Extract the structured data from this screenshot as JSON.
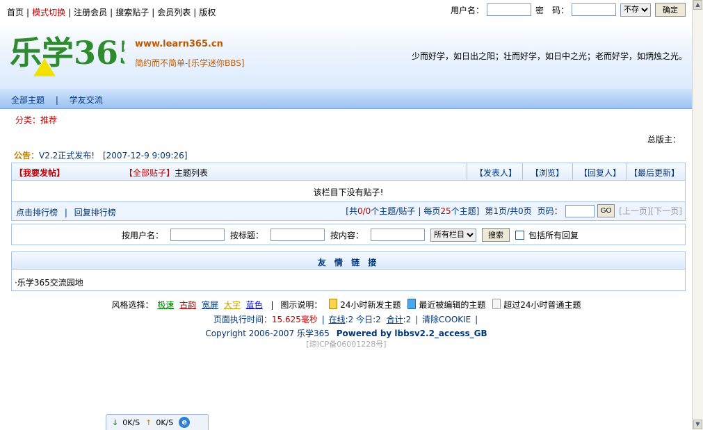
{
  "topnav": {
    "home": "首页",
    "mode": "模式切换",
    "register": "注册会员",
    "search": "搜索贴子",
    "members": "会员列表",
    "copyright": "版权"
  },
  "login": {
    "username_label": "用户名：",
    "password_label": "密　码：",
    "remember_option": "不存",
    "submit": "确定"
  },
  "header": {
    "logo_text": "乐学365",
    "url": "www.learn365.cn",
    "slogan": "简约而不简单-[乐学迷你BBS]",
    "quote": "少而好学，如日出之阳；壮而好学，如日中之光；老而好学，如炳烛之光。"
  },
  "navbar": {
    "items": [
      "全部主题",
      "学友交流"
    ],
    "sep": "|"
  },
  "category": {
    "label": "分类：",
    "value": "推荐"
  },
  "moderator": "总版主：",
  "notice": {
    "label": "公告：",
    "text": "V2.2正式发布!",
    "time": "[2007-12-9 9:09:26]"
  },
  "table_header": {
    "post": "【我要发帖】",
    "all_posts": "【全部贴子】",
    "topic_list": "主题列表",
    "author": "【发表人】",
    "views": "【浏览】",
    "replier": "【回复人】",
    "last_update": "【最后更新】"
  },
  "empty_message": "该栏目下没有贴子!",
  "pager": {
    "rank_click": "点击排行榜",
    "rank_reply": "回复排行榜",
    "total_prefix": "[共",
    "total_value": "0/0",
    "total_suffix": "个主题/贴子",
    "per_page_prefix": "每页",
    "per_page_value": "25",
    "per_page_suffix": "个主题]",
    "page_info": "第1页/共0页",
    "page_label": "页码：",
    "go": "GO",
    "prev": "[上一页]",
    "next": "[下一页]"
  },
  "search": {
    "by_user": "按用户名：",
    "by_title": "按标题：",
    "by_content": "按内容：",
    "column_option": "所有栏目",
    "submit": "搜索",
    "include_replies": "包括所有回复"
  },
  "links": {
    "title": "友 情 链 接",
    "item": "·乐学365交流园地"
  },
  "footer": {
    "style_label": "风格选择：",
    "styles": [
      {
        "label": "极速",
        "color": "#008000"
      },
      {
        "label": "古韵",
        "color": "#8b0000"
      },
      {
        "label": "宽屏",
        "color": "#00357a"
      },
      {
        "label": "大字",
        "color": "#c8a000"
      },
      {
        "label": "蓝色",
        "color": "#0000cc"
      }
    ],
    "legend_label": "图示说明：",
    "legend_new": "24小时新发主题",
    "legend_edited": "最近被编辑的主题",
    "legend_normal": "超过24小时普通主题",
    "exec_label": "页面执行时间：",
    "exec_value": "15.625毫秒",
    "online_label": "在线",
    "online_value": ":2 今日:2",
    "total_label": "合计",
    "total_value": ":2",
    "clear_cookie": "清除COOKIE",
    "copyright": "Copyright 2006-2007 乐学365",
    "powered": "Powered by lbbsv2.2_access_GB",
    "icp": "[琼ICP备06001228号]"
  },
  "statusbar": {
    "down": "0K/S",
    "up": "0K/S"
  },
  "colors": {
    "accent_blue": "#00357a",
    "red": "#c00000",
    "header_orange": "#c05800"
  }
}
